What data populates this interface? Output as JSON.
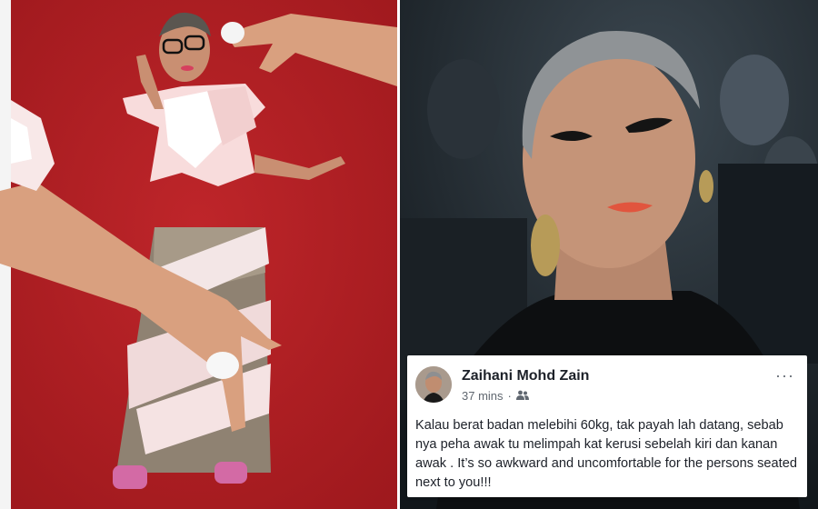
{
  "post": {
    "author_name": "Zaihani Mohd Zain",
    "timestamp": "37 mins",
    "separator": "·",
    "audience_icon": "friends-icon",
    "more_icon": "more-options-icon",
    "more_label": "···",
    "body_text": "Kalau berat badan melebihi 60kg, tak payah lah datang, sebab nya peha awak tu melimpah kat kerusi sebelah kiri dan kanan awak . It’s so awkward and uncomfortable for the persons seated next to you!!!"
  },
  "colors": {
    "left_backdrop": "#b71f24",
    "right_backdrop": "#1c2227",
    "text_primary": "#1d2129",
    "text_secondary": "#606770"
  }
}
